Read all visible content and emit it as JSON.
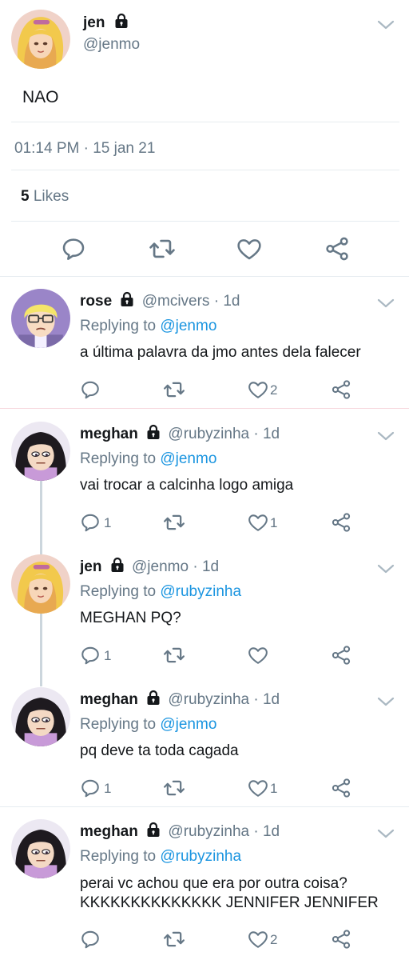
{
  "main_tweet": {
    "name": "jen",
    "handle": "@jenmo",
    "text": "NAO",
    "timestamp": "01:14 PM · 15 jan 21",
    "likes_count": "5",
    "likes_label": "Likes"
  },
  "replies": [
    {
      "name": "rose",
      "handle": "@mcivers",
      "time": "· 1d",
      "replying_prefix": "Replying to",
      "replying_to": "@jenmo",
      "text": [
        "a última palavra da jmo antes dela falecer"
      ],
      "reply_count": "",
      "like_count": "2"
    },
    {
      "name": "meghan",
      "handle": "@rubyzinha",
      "time": "· 1d",
      "replying_prefix": "Replying to",
      "replying_to": "@jenmo",
      "text": [
        "vai trocar a calcinha logo amiga"
      ],
      "reply_count": "1",
      "like_count": "1"
    },
    {
      "name": "jen",
      "handle": "@jenmo",
      "time": "· 1d",
      "replying_prefix": "Replying to",
      "replying_to": "@rubyzinha",
      "text": [
        "MEGHAN PQ?"
      ],
      "reply_count": "1",
      "like_count": ""
    },
    {
      "name": "meghan",
      "handle": "@rubyzinha",
      "time": "· 1d",
      "replying_prefix": "Replying to",
      "replying_to": "@jenmo",
      "text": [
        "pq deve ta toda cagada"
      ],
      "reply_count": "1",
      "like_count": "1"
    },
    {
      "name": "meghan",
      "handle": "@rubyzinha",
      "time": "· 1d",
      "replying_prefix": "Replying to",
      "replying_to": "@rubyzinha",
      "text": [
        "perai vc achou que era por outra coisa?",
        "KKKKKKKKKKKKKK JENNIFER JENNIFER"
      ],
      "reply_count": "",
      "like_count": "2"
    }
  ],
  "colors": {
    "link": "#1b95e0",
    "muted": "#657786",
    "separator": "#e6ecf0",
    "thread_line": "#ccd6dd"
  },
  "icons": [
    "reply-icon",
    "retweet-icon",
    "like-icon",
    "share-icon",
    "lock-icon",
    "chevron-down-icon"
  ]
}
